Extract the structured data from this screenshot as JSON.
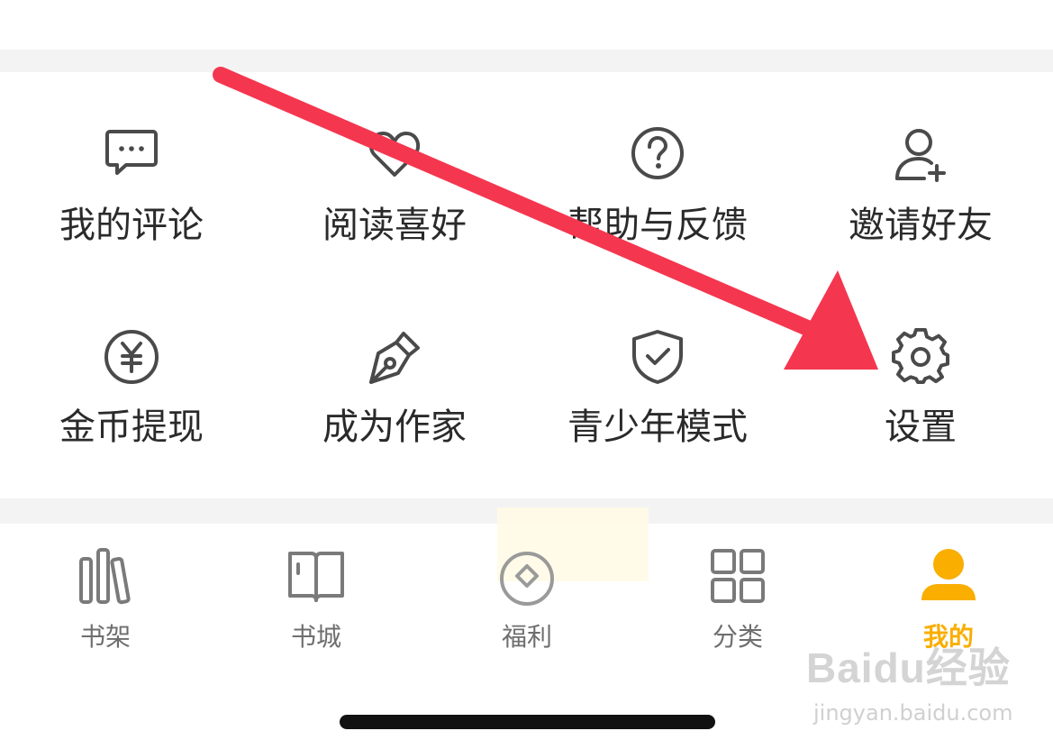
{
  "grid": {
    "items": [
      {
        "label": "我的评论",
        "icon": "comment-icon"
      },
      {
        "label": "阅读喜好",
        "icon": "heart-icon"
      },
      {
        "label": "帮助与反馈",
        "icon": "help-icon"
      },
      {
        "label": "邀请好友",
        "icon": "add-friend-icon"
      },
      {
        "label": "金币提现",
        "icon": "coin-icon"
      },
      {
        "label": "成为作家",
        "icon": "pen-icon"
      },
      {
        "label": "青少年模式",
        "icon": "shield-check-icon"
      },
      {
        "label": "设置",
        "icon": "gear-icon"
      }
    ]
  },
  "tabbar": {
    "items": [
      {
        "label": "书架",
        "icon": "bookshelf-icon"
      },
      {
        "label": "书城",
        "icon": "book-icon"
      },
      {
        "label": "福利",
        "icon": "coin-diamond-icon"
      },
      {
        "label": "分类",
        "icon": "grid-icon"
      },
      {
        "label": "我的",
        "icon": "user-icon"
      }
    ],
    "active_index": 4
  },
  "watermark": {
    "logo": "Baidu经验",
    "url": "jingyan.baidu.com"
  },
  "colors": {
    "accent": "#f9ae00",
    "arrow": "#f5364f",
    "icon": "#4a4a4a",
    "tab_inactive": "#7a7a7a",
    "separator": "#f3f3f3"
  }
}
